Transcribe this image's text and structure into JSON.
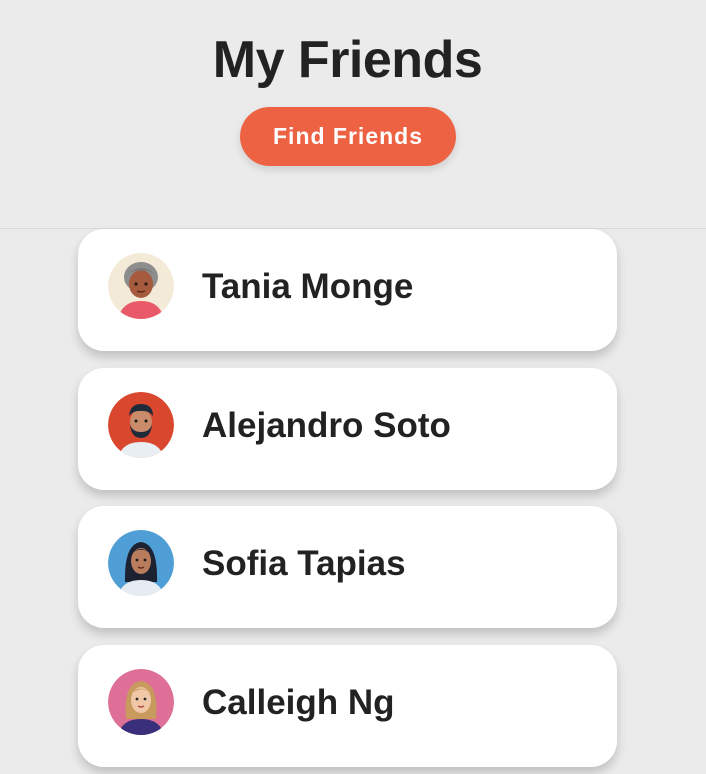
{
  "header": {
    "title": "My Friends",
    "find_button_label": "Find Friends"
  },
  "friends": [
    {
      "name": "Tania Monge",
      "avatar_icon": "avatar-gray-haired-woman-icon"
    },
    {
      "name": "Alejandro Soto",
      "avatar_icon": "avatar-bearded-man-icon"
    },
    {
      "name": "Sofia Tapias",
      "avatar_icon": "avatar-dark-haired-woman-icon"
    },
    {
      "name": "Calleigh Ng",
      "avatar_icon": "avatar-blonde-woman-icon"
    }
  ],
  "colors": {
    "background": "#ebebeb",
    "accent": "#ee6244",
    "card": "#ffffff",
    "text": "#222222"
  }
}
